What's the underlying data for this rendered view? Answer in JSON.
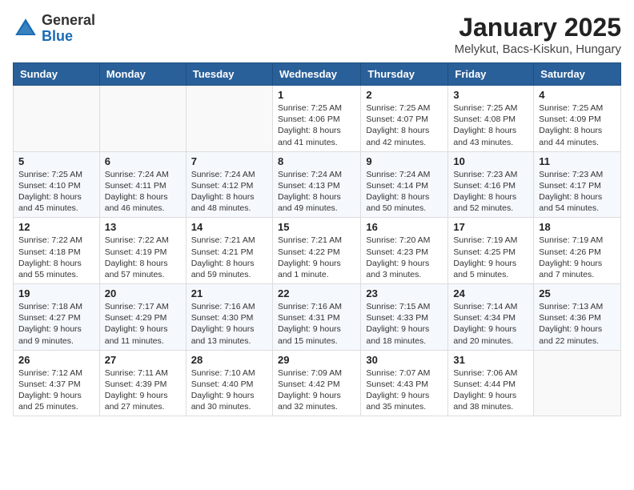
{
  "logo": {
    "general": "General",
    "blue": "Blue"
  },
  "title": "January 2025",
  "subtitle": "Melykut, Bacs-Kiskun, Hungary",
  "days_of_week": [
    "Sunday",
    "Monday",
    "Tuesday",
    "Wednesday",
    "Thursday",
    "Friday",
    "Saturday"
  ],
  "weeks": [
    [
      {
        "day": "",
        "info": ""
      },
      {
        "day": "",
        "info": ""
      },
      {
        "day": "",
        "info": ""
      },
      {
        "day": "1",
        "info": "Sunrise: 7:25 AM\nSunset: 4:06 PM\nDaylight: 8 hours and 41 minutes."
      },
      {
        "day": "2",
        "info": "Sunrise: 7:25 AM\nSunset: 4:07 PM\nDaylight: 8 hours and 42 minutes."
      },
      {
        "day": "3",
        "info": "Sunrise: 7:25 AM\nSunset: 4:08 PM\nDaylight: 8 hours and 43 minutes."
      },
      {
        "day": "4",
        "info": "Sunrise: 7:25 AM\nSunset: 4:09 PM\nDaylight: 8 hours and 44 minutes."
      }
    ],
    [
      {
        "day": "5",
        "info": "Sunrise: 7:25 AM\nSunset: 4:10 PM\nDaylight: 8 hours and 45 minutes."
      },
      {
        "day": "6",
        "info": "Sunrise: 7:24 AM\nSunset: 4:11 PM\nDaylight: 8 hours and 46 minutes."
      },
      {
        "day": "7",
        "info": "Sunrise: 7:24 AM\nSunset: 4:12 PM\nDaylight: 8 hours and 48 minutes."
      },
      {
        "day": "8",
        "info": "Sunrise: 7:24 AM\nSunset: 4:13 PM\nDaylight: 8 hours and 49 minutes."
      },
      {
        "day": "9",
        "info": "Sunrise: 7:24 AM\nSunset: 4:14 PM\nDaylight: 8 hours and 50 minutes."
      },
      {
        "day": "10",
        "info": "Sunrise: 7:23 AM\nSunset: 4:16 PM\nDaylight: 8 hours and 52 minutes."
      },
      {
        "day": "11",
        "info": "Sunrise: 7:23 AM\nSunset: 4:17 PM\nDaylight: 8 hours and 54 minutes."
      }
    ],
    [
      {
        "day": "12",
        "info": "Sunrise: 7:22 AM\nSunset: 4:18 PM\nDaylight: 8 hours and 55 minutes."
      },
      {
        "day": "13",
        "info": "Sunrise: 7:22 AM\nSunset: 4:19 PM\nDaylight: 8 hours and 57 minutes."
      },
      {
        "day": "14",
        "info": "Sunrise: 7:21 AM\nSunset: 4:21 PM\nDaylight: 8 hours and 59 minutes."
      },
      {
        "day": "15",
        "info": "Sunrise: 7:21 AM\nSunset: 4:22 PM\nDaylight: 9 hours and 1 minute."
      },
      {
        "day": "16",
        "info": "Sunrise: 7:20 AM\nSunset: 4:23 PM\nDaylight: 9 hours and 3 minutes."
      },
      {
        "day": "17",
        "info": "Sunrise: 7:19 AM\nSunset: 4:25 PM\nDaylight: 9 hours and 5 minutes."
      },
      {
        "day": "18",
        "info": "Sunrise: 7:19 AM\nSunset: 4:26 PM\nDaylight: 9 hours and 7 minutes."
      }
    ],
    [
      {
        "day": "19",
        "info": "Sunrise: 7:18 AM\nSunset: 4:27 PM\nDaylight: 9 hours and 9 minutes."
      },
      {
        "day": "20",
        "info": "Sunrise: 7:17 AM\nSunset: 4:29 PM\nDaylight: 9 hours and 11 minutes."
      },
      {
        "day": "21",
        "info": "Sunrise: 7:16 AM\nSunset: 4:30 PM\nDaylight: 9 hours and 13 minutes."
      },
      {
        "day": "22",
        "info": "Sunrise: 7:16 AM\nSunset: 4:31 PM\nDaylight: 9 hours and 15 minutes."
      },
      {
        "day": "23",
        "info": "Sunrise: 7:15 AM\nSunset: 4:33 PM\nDaylight: 9 hours and 18 minutes."
      },
      {
        "day": "24",
        "info": "Sunrise: 7:14 AM\nSunset: 4:34 PM\nDaylight: 9 hours and 20 minutes."
      },
      {
        "day": "25",
        "info": "Sunrise: 7:13 AM\nSunset: 4:36 PM\nDaylight: 9 hours and 22 minutes."
      }
    ],
    [
      {
        "day": "26",
        "info": "Sunrise: 7:12 AM\nSunset: 4:37 PM\nDaylight: 9 hours and 25 minutes."
      },
      {
        "day": "27",
        "info": "Sunrise: 7:11 AM\nSunset: 4:39 PM\nDaylight: 9 hours and 27 minutes."
      },
      {
        "day": "28",
        "info": "Sunrise: 7:10 AM\nSunset: 4:40 PM\nDaylight: 9 hours and 30 minutes."
      },
      {
        "day": "29",
        "info": "Sunrise: 7:09 AM\nSunset: 4:42 PM\nDaylight: 9 hours and 32 minutes."
      },
      {
        "day": "30",
        "info": "Sunrise: 7:07 AM\nSunset: 4:43 PM\nDaylight: 9 hours and 35 minutes."
      },
      {
        "day": "31",
        "info": "Sunrise: 7:06 AM\nSunset: 4:44 PM\nDaylight: 9 hours and 38 minutes."
      },
      {
        "day": "",
        "info": ""
      }
    ]
  ]
}
